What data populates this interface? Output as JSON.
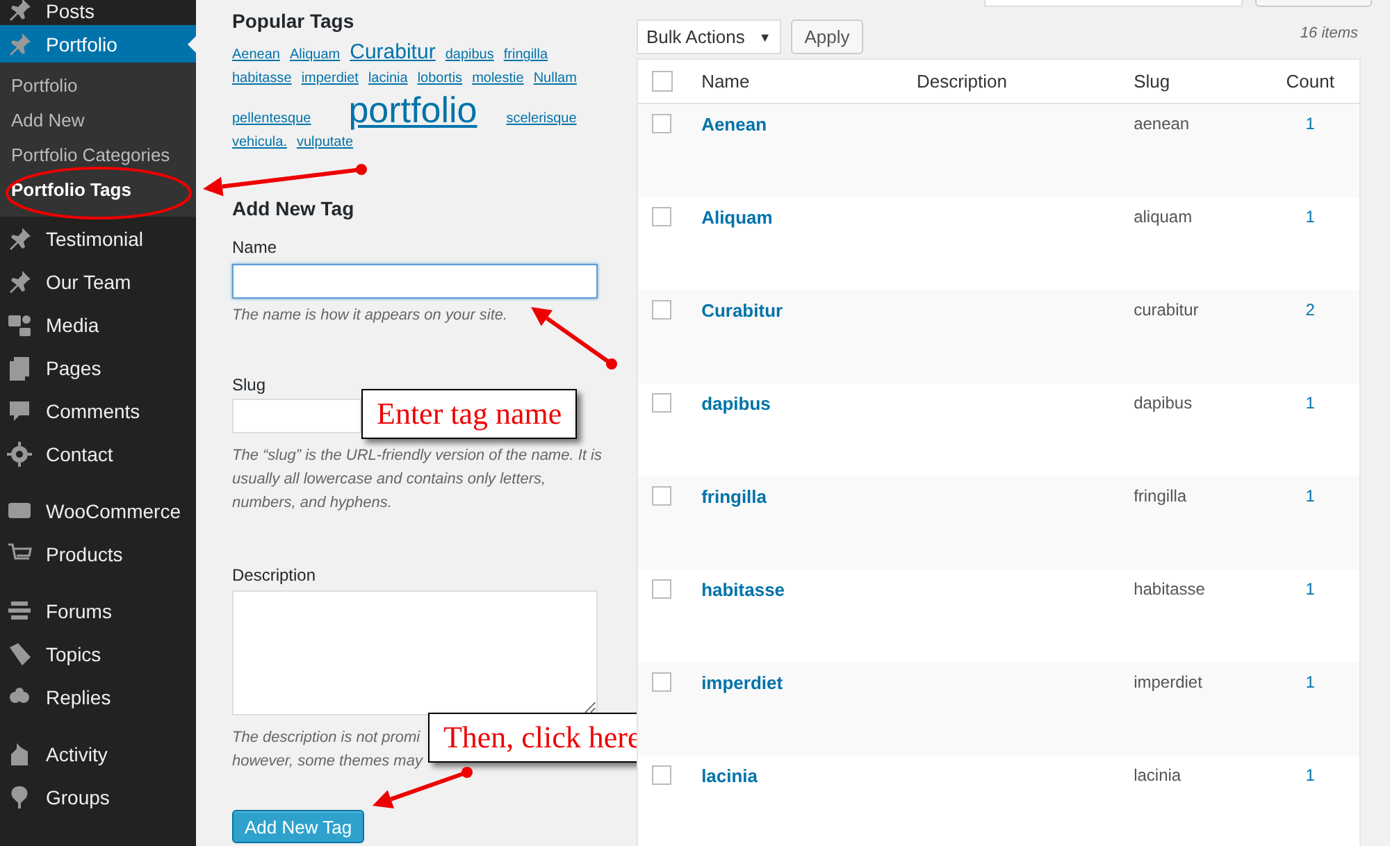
{
  "sidebar": {
    "groups": [
      [
        {
          "label": "Posts",
          "selected": false
        },
        {
          "label": "Portfolio",
          "selected": true,
          "children": [
            {
              "label": "Portfolio",
              "selected": false
            },
            {
              "label": "Add New",
              "selected": false
            },
            {
              "label": "Portfolio Categories",
              "selected": false
            },
            {
              "label": "Portfolio Tags",
              "selected": true
            }
          ]
        },
        {
          "label": "Testimonial",
          "selected": false
        },
        {
          "label": "Our Team",
          "selected": false
        },
        {
          "label": "Media",
          "selected": false
        },
        {
          "label": "Pages",
          "selected": false
        },
        {
          "label": "Comments",
          "selected": false
        },
        {
          "label": "Contact",
          "selected": false
        }
      ],
      [
        {
          "label": "WooCommerce",
          "selected": false
        },
        {
          "label": "Products",
          "selected": false
        }
      ],
      [
        {
          "label": "Forums",
          "selected": false
        },
        {
          "label": "Topics",
          "selected": false
        },
        {
          "label": "Replies",
          "selected": false
        }
      ],
      [
        {
          "label": "Activity",
          "selected": false
        },
        {
          "label": "Groups",
          "selected": false
        }
      ]
    ]
  },
  "popular_tags": {
    "title": "Popular Tags",
    "tags": [
      {
        "label": "Aenean",
        "kind": "small"
      },
      {
        "label": "Aliquam",
        "kind": "small"
      },
      {
        "label": "Curabitur",
        "kind": "large"
      },
      {
        "label": "dapibus",
        "kind": "small"
      },
      {
        "label": "fringilla",
        "kind": "small"
      },
      {
        "label": "habitasse",
        "kind": "small"
      },
      {
        "label": "imperdiet",
        "kind": "small"
      },
      {
        "label": "lacinia",
        "kind": "small"
      },
      {
        "label": "lobortis",
        "kind": "small"
      },
      {
        "label": "molestie",
        "kind": "small"
      },
      {
        "label": "Nullam",
        "kind": "small"
      },
      {
        "label": "pellentesque",
        "kind": "small"
      },
      {
        "label": "portfolio",
        "kind": "largest"
      },
      {
        "label": "scelerisque",
        "kind": "small"
      },
      {
        "label": "vehicula.",
        "kind": "small"
      },
      {
        "label": "vulputate",
        "kind": "small"
      }
    ]
  },
  "add_form": {
    "title": "Add New Tag",
    "name": {
      "label": "Name",
      "hint": "The name is how it appears on your site.",
      "focused": true
    },
    "slug": {
      "label": "Slug",
      "hint": "The “slug” is the URL-friendly version of the name. It is usually all lowercase and contains only letters, numbers, and hyphens."
    },
    "description": {
      "label": "Description",
      "hint_lines": [
        "The description is not promi",
        "however, some themes may"
      ]
    },
    "submit": "Add New Tag"
  },
  "annotations": {
    "callouts": [
      "Enter tag name",
      "Then, click here"
    ]
  },
  "toolbar": {
    "bulk_actions": "Bulk Actions",
    "caret": "▼",
    "apply": "Apply",
    "count": "16 items"
  },
  "table": {
    "select_all_checked": false,
    "columns": [
      "Name",
      "Description",
      "Slug",
      "Count"
    ],
    "rows": [
      {
        "checked": false,
        "name": "Aenean",
        "slug": "aenean",
        "count": "1"
      },
      {
        "checked": false,
        "name": "Aliquam",
        "slug": "aliquam",
        "count": "1"
      },
      {
        "checked": false,
        "name": "Curabitur",
        "slug": "curabitur",
        "count": "2"
      },
      {
        "checked": false,
        "name": "dapibus",
        "slug": "dapibus",
        "count": "1"
      },
      {
        "checked": false,
        "name": "fringilla",
        "slug": "fringilla",
        "count": "1"
      },
      {
        "checked": false,
        "name": "habitasse",
        "slug": "habitasse",
        "count": "1"
      },
      {
        "checked": false,
        "name": "imperdiet",
        "slug": "imperdiet",
        "count": "1"
      },
      {
        "checked": false,
        "name": "lacinia",
        "slug": "lacinia",
        "count": "1"
      }
    ]
  }
}
